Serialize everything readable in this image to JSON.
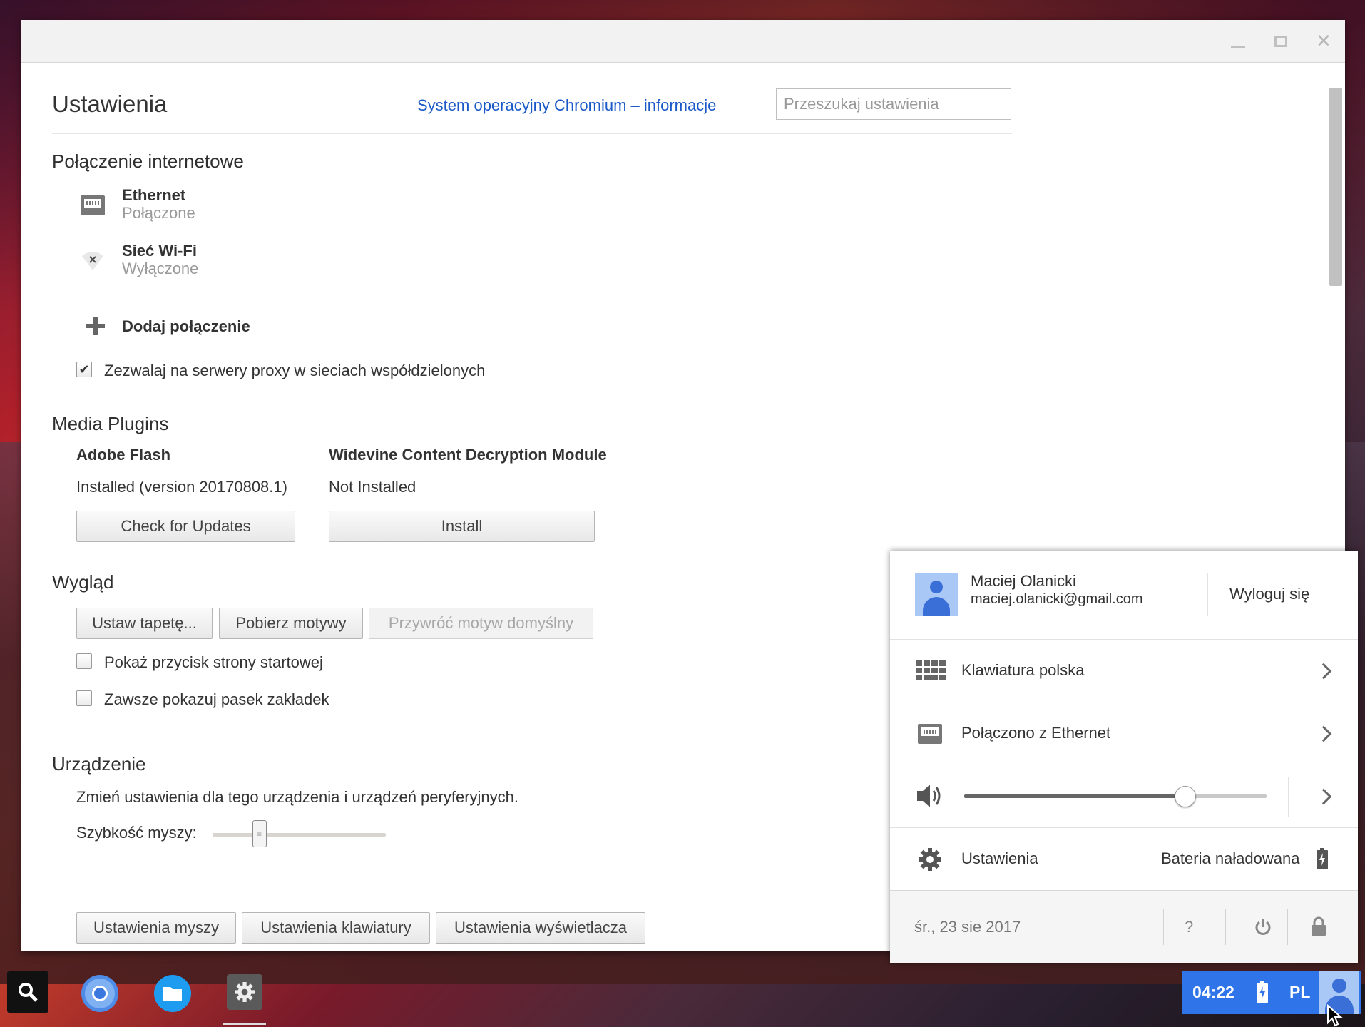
{
  "window": {
    "controls": {
      "minimize": "minimize-icon",
      "maximize": "maximize-icon",
      "close_glyph": "✕"
    }
  },
  "header": {
    "title": "Ustawienia",
    "about_link": "System operacyjny Chromium – informacje",
    "search_placeholder": "Przeszukaj ustawienia"
  },
  "internet": {
    "title": "Połączenie internetowe",
    "networks": [
      {
        "name": "Ethernet",
        "status": "Połączone",
        "icon": "ethernet-icon"
      },
      {
        "name": "Sieć Wi-Fi",
        "status": "Wyłączone",
        "icon": "wifi-off-icon"
      }
    ],
    "add_connection": "Dodaj połączenie",
    "proxy_checkbox": {
      "label": "Zezwalaj na serwery proxy w sieciach współdzielonych",
      "checked": true
    }
  },
  "media": {
    "title": "Media Plugins",
    "plugins": [
      {
        "name": "Adobe Flash",
        "status": "Installed (version 20170808.1)",
        "button": "Check for Updates"
      },
      {
        "name": "Widevine Content Decryption Module",
        "status": "Not Installed",
        "button": "Install"
      }
    ]
  },
  "appearance": {
    "title": "Wygląd",
    "buttons": [
      "Ustaw tapetę...",
      "Pobierz motywy",
      "Przywróć motyw domyślny"
    ],
    "checkboxes": [
      {
        "label": "Pokaż przycisk strony startowej",
        "checked": false
      },
      {
        "label": "Zawsze pokazuj pasek zakładek",
        "checked": false
      }
    ]
  },
  "device": {
    "title": "Urządzenie",
    "description": "Zmień ustawienia dla tego urządzenia i urządzeń peryferyjnych.",
    "mouse_speed_label": "Szybkość myszy:",
    "mouse_speed_level": 0.27,
    "buttons": [
      "Ustawienia myszy",
      "Ustawienia klawiatury",
      "Ustawienia wyświetlacza"
    ]
  },
  "tray": {
    "user_name": "Maciej Olanicki",
    "user_email": "maciej.olanicki@gmail.com",
    "sign_out": "Wyloguj się",
    "keyboard": "Klawiatura polska",
    "network": "Połączono z Ethernet",
    "volume_level": 0.73,
    "settings": "Ustawienia",
    "battery": "Bateria naładowana",
    "date": "śr., 23 sie 2017",
    "help": "?"
  },
  "status_area": {
    "time": "04:22",
    "language": "PL"
  },
  "colors": {
    "link": "#1a59c8",
    "status_area": "#2f74e8",
    "avatar_bg": "#aac8f5",
    "avatar_fg": "#3a6fd8"
  }
}
